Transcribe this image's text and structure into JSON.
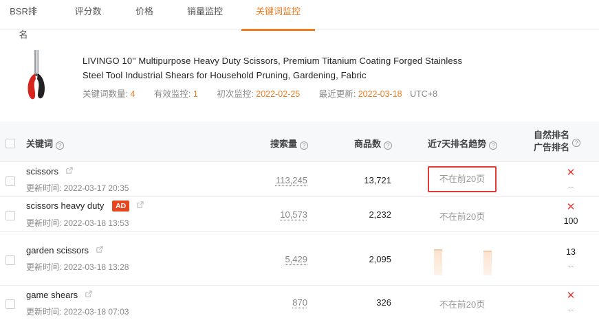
{
  "tabs": [
    {
      "label": "BSR排名",
      "active": false
    },
    {
      "label": "评分数",
      "active": false
    },
    {
      "label": "价格",
      "active": false
    },
    {
      "label": "销量监控",
      "active": false
    },
    {
      "label": "关键词监控",
      "active": true
    }
  ],
  "product": {
    "title_line1": "LIVINGO 10'' Multipurpose Heavy Duty Scissors, Premium Titanium Coating Forged Stainless",
    "title_line2": "Steel Tool Industrial Shears for Household Pruning, Gardening, Fabric",
    "keyword_count_label": "关键词数量:",
    "keyword_count": "4",
    "valid_monitor_label": "有效监控:",
    "valid_monitor": "1",
    "first_monitor_label": "初次监控:",
    "first_monitor": "2022-02-25",
    "last_update_label": "最近更新:",
    "last_update": "2022-03-18",
    "timezone": "UTC+8"
  },
  "table": {
    "headers": {
      "keyword": "关键词",
      "search_volume": "搜索量",
      "product_count": "商品数",
      "trend": "近7天排名趋势",
      "organic_rank": "自然排名",
      "ad_rank": "广告排名"
    },
    "rows": [
      {
        "keyword": "scissors",
        "ad": "",
        "updated": "更新时间: 2022-03-17 20:35",
        "volume": "113,245",
        "count": "13,721",
        "trend": "不在前20页",
        "organic": "✕",
        "ad_rank": "--"
      },
      {
        "keyword": "scissors heavy duty",
        "ad": "AD",
        "updated": "更新时间: 2022-03-18 13:53",
        "volume": "10,573",
        "count": "2,232",
        "trend": "不在前20页",
        "organic": "✕",
        "ad_rank": "100"
      },
      {
        "keyword": "garden scissors",
        "ad": "",
        "updated": "更新时间: 2022-03-18 13:28",
        "volume": "5,429",
        "count": "2,095",
        "trend": "",
        "organic": "13",
        "ad_rank": "--"
      },
      {
        "keyword": "game shears",
        "ad": "",
        "updated": "更新时间: 2022-03-18 07:03",
        "volume": "870",
        "count": "326",
        "trend": "不在前20页",
        "organic": "✕",
        "ad_rank": "--"
      }
    ]
  },
  "icons": {
    "help": "question-circle-icon",
    "external": "external-link-icon",
    "no_rank": "close-x-icon"
  },
  "colors": {
    "accent": "#ee7d22",
    "ad_badge": "#e5451f",
    "no_rank": "#e53935"
  }
}
